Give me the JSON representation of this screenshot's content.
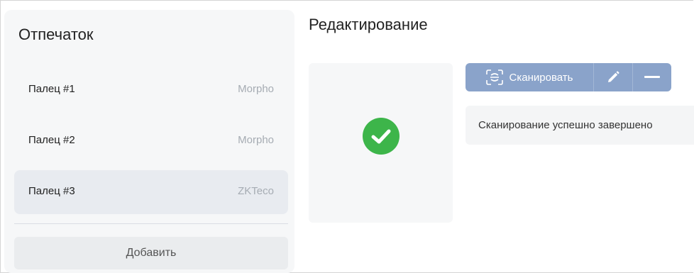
{
  "left_panel": {
    "title": "Отпечаток",
    "fingers": [
      {
        "name": "Палец #1",
        "vendor": "Morpho",
        "selected": false
      },
      {
        "name": "Палец #2",
        "vendor": "Morpho",
        "selected": false
      },
      {
        "name": "Палец #3",
        "vendor": "ZKTeco",
        "selected": true
      }
    ],
    "add_label": "Добавить"
  },
  "edit": {
    "title": "Редактирование",
    "scan_label": "Сканировать",
    "status": "Сканирование успешно завершено",
    "scan_result_icon": "check-circle-icon"
  },
  "colors": {
    "toolbar": "#8aa3ca",
    "success": "#3db54a",
    "selected_row": "#e8ebf0"
  }
}
